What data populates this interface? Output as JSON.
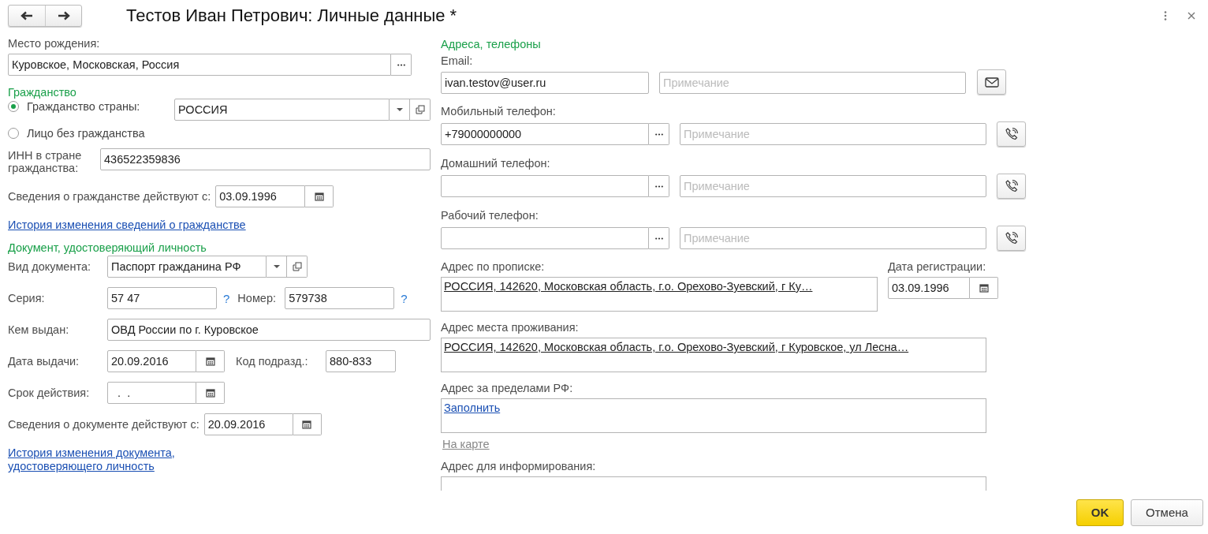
{
  "window": {
    "title": "Тестов Иван Петрович: Личные данные *"
  },
  "birthplace": {
    "label": "Место рождения:",
    "value": "Куровское, Московская, Россия"
  },
  "citizenship": {
    "heading": "Гражданство",
    "options": [
      {
        "label": "Гражданство страны:",
        "selected": true
      },
      {
        "label": "Лицо без гражданства",
        "selected": false
      }
    ],
    "country": "РОССИЯ",
    "inn_label": "ИНН в стране гражданства:",
    "inn": "436522359836",
    "valid_from_label": "Сведения о гражданстве действуют с:",
    "valid_from": "03.09.1996",
    "history_link": "История изменения сведений о гражданстве"
  },
  "document": {
    "heading": "Документ, удостоверяющий личность",
    "type_label": "Вид документа:",
    "type": "Паспорт гражданина РФ",
    "series_label": "Серия:",
    "series": "57 47",
    "series_help": "?",
    "number_label": "Номер:",
    "number": "579738",
    "number_help": "?",
    "issued_by_label": "Кем выдан:",
    "issued_by": "ОВД России по г. Куровское",
    "issue_date_label": "Дата выдачи:",
    "issue_date": "20.09.2016",
    "dept_code_label": "Код подразд.:",
    "dept_code": "880-833",
    "expiry_label": "Срок действия:",
    "expiry": "  .  .",
    "valid_from_label": "Сведения о документе действуют с:",
    "valid_from": "20.09.2016",
    "history_link": "История изменения документа, удостоверяющего личность"
  },
  "contacts": {
    "heading": "Адреса, телефоны",
    "rows": [
      {
        "kind": "email",
        "label": "Email:",
        "value": "ivan.testov@user.ru",
        "placeholder": "Примечание"
      },
      {
        "kind": "phone",
        "label": "Мобильный телефон:",
        "value": "+79000000000",
        "placeholder": "Примечание"
      },
      {
        "kind": "phone",
        "label": "Домашний телефон:",
        "placeholder": "Примечание"
      },
      {
        "kind": "phone",
        "label": "Рабочий телефон:",
        "placeholder": "Примечание"
      }
    ]
  },
  "addresses": {
    "registration": {
      "label": "Адрес по прописке:",
      "value": "РОССИЯ, 142620, Московская область, г.о. Орехово-Зуевский, г Ку…",
      "date_label": "Дата регистрации:",
      "date": "03.09.1996"
    },
    "residence": {
      "label": "Адрес места проживания:",
      "value": "РОССИЯ, 142620, Московская область, г.о. Орехово-Зуевский, г Куровское, ул Лесна…"
    },
    "abroad": {
      "label": "Адрес за пределами РФ:",
      "link": "Заполнить"
    },
    "map_link": "На карте",
    "informing": {
      "label": "Адрес для информирования:"
    }
  },
  "buttons": [
    {
      "kind": "primary",
      "label": "OK"
    },
    {
      "kind": "default",
      "label": "Отмена"
    }
  ]
}
